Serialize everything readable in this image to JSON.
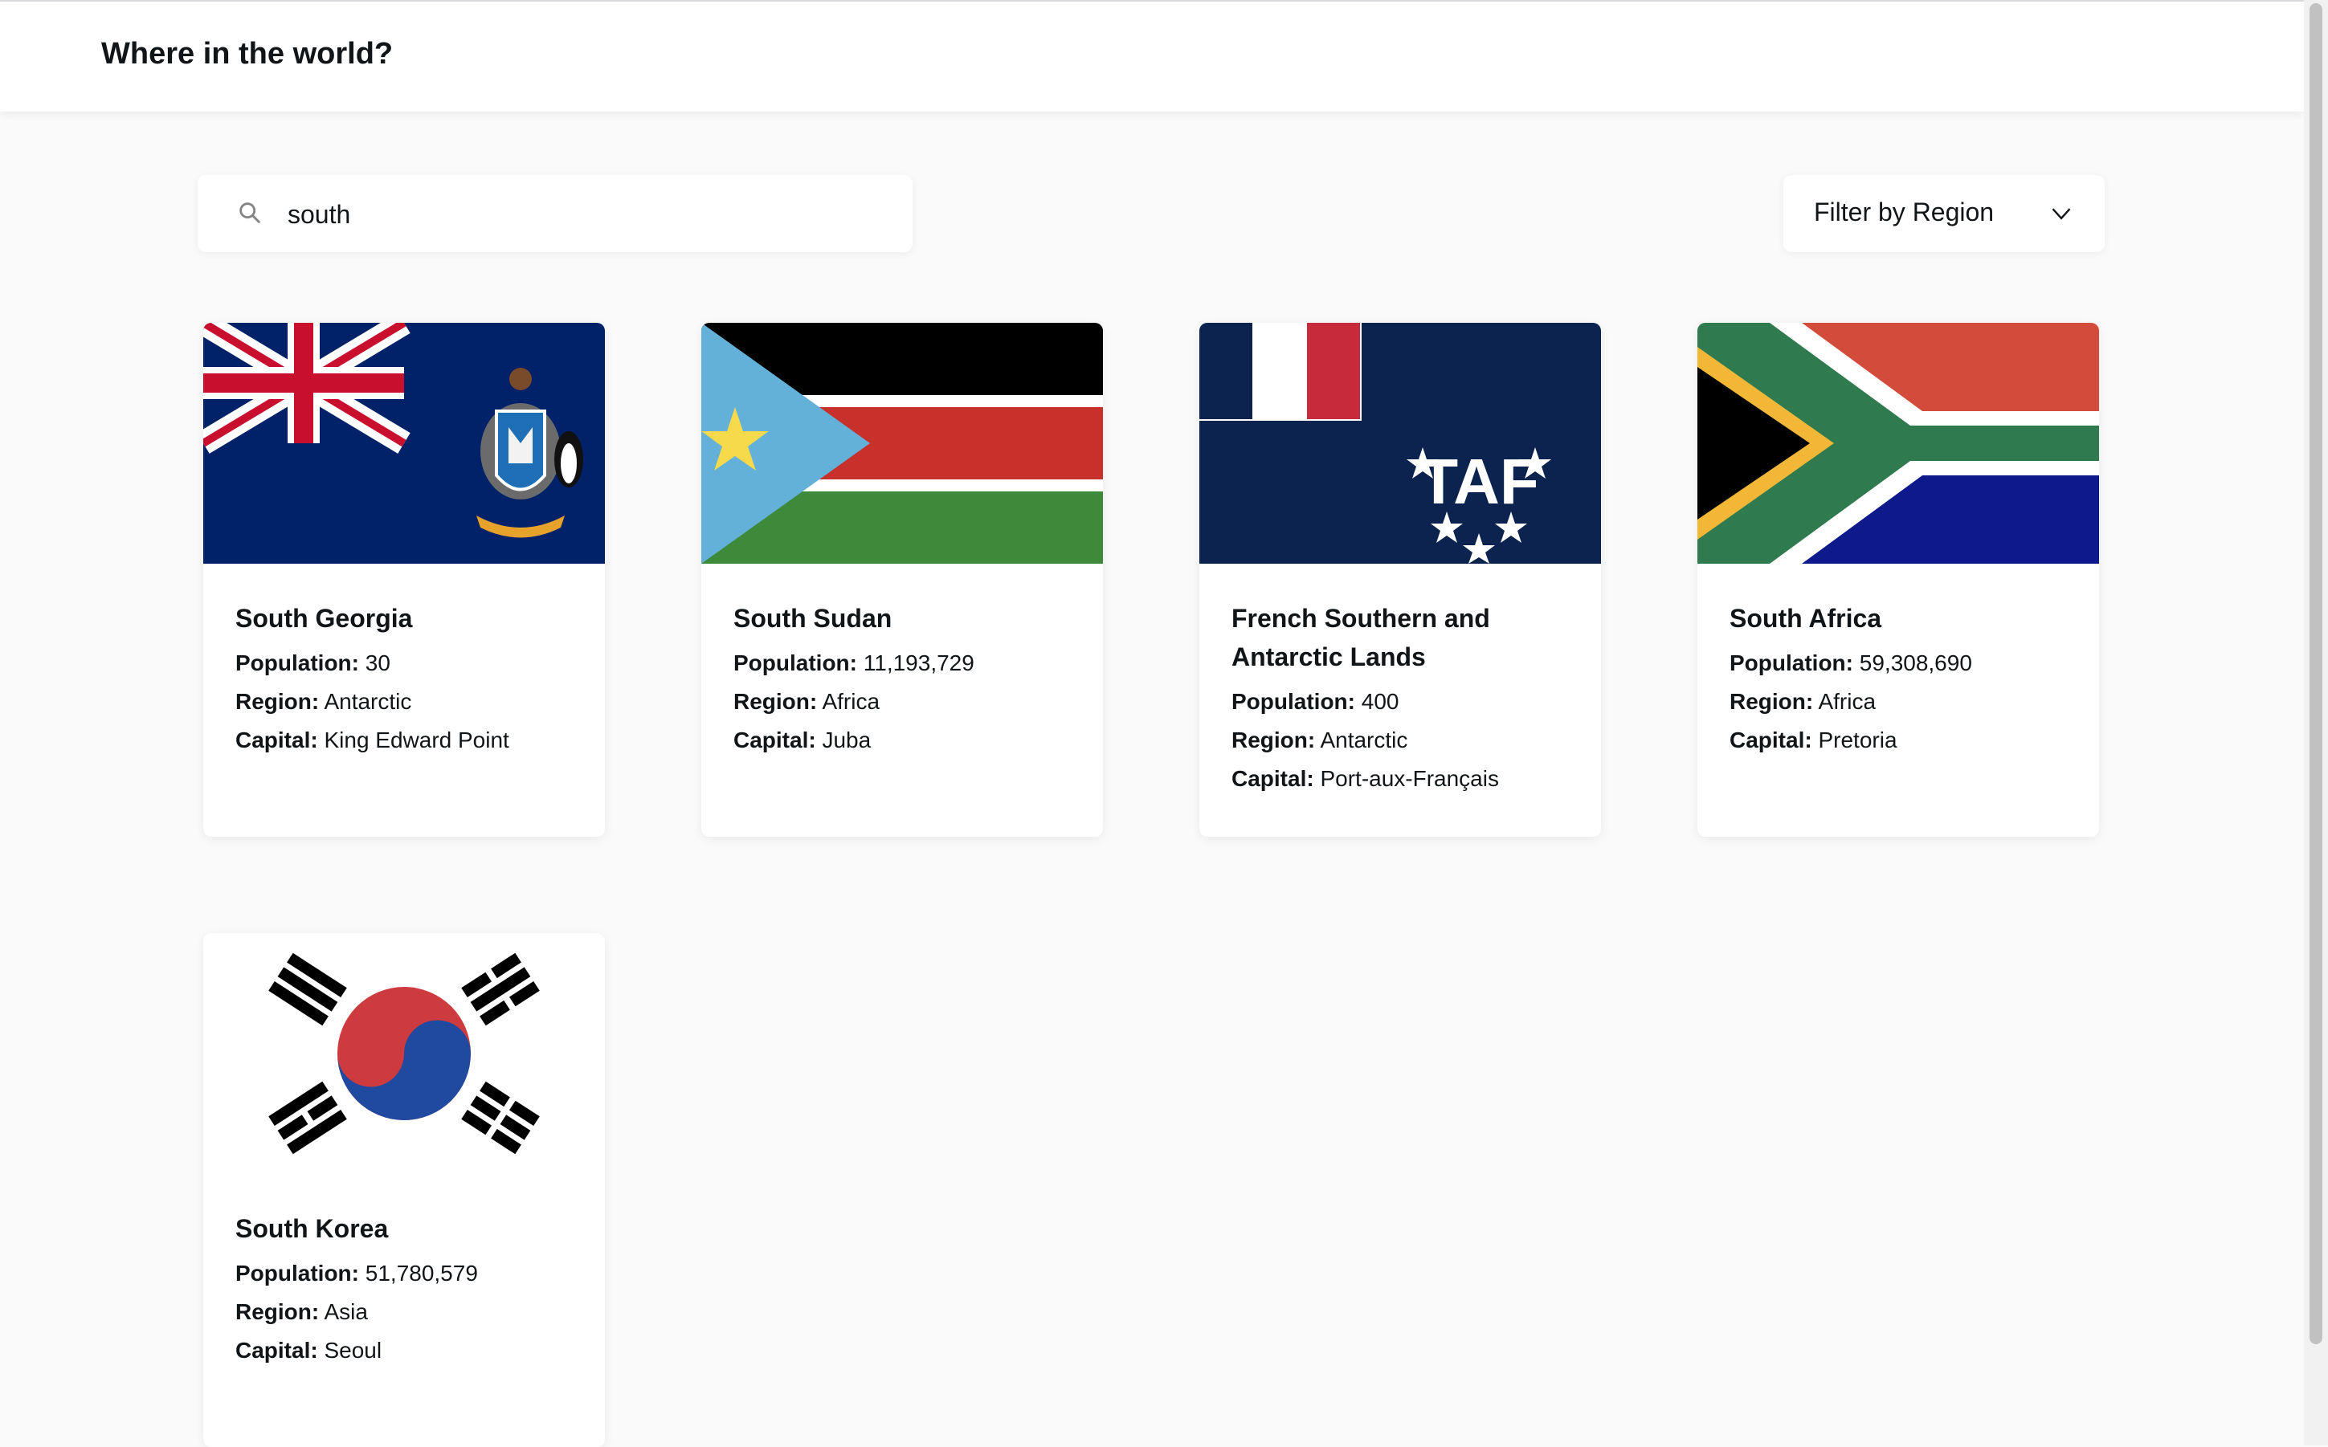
{
  "header": {
    "title": "Where in the world?"
  },
  "search": {
    "value": "south",
    "icon": "search-icon"
  },
  "filter": {
    "label": "Filter by Region",
    "icon": "chevron-down-icon"
  },
  "labels": {
    "population": "Population:",
    "region": "Region:",
    "capital": "Capital:"
  },
  "countries": [
    {
      "name": "South Georgia",
      "population": "30",
      "region": "Antarctic",
      "capital": "King Edward Point",
      "flag": "south-georgia-flag"
    },
    {
      "name": "South Sudan",
      "population": "11,193,729",
      "region": "Africa",
      "capital": "Juba",
      "flag": "south-sudan-flag"
    },
    {
      "name": "French Southern and Antarctic Lands",
      "population": "400",
      "region": "Antarctic",
      "capital": "Port-aux-Français",
      "flag": "french-southern-flag"
    },
    {
      "name": "South Africa",
      "population": "59,308,690",
      "region": "Africa",
      "capital": "Pretoria",
      "flag": "south-africa-flag"
    },
    {
      "name": "South Korea",
      "population": "51,780,579",
      "region": "Asia",
      "capital": "Seoul",
      "flag": "south-korea-flag"
    }
  ]
}
